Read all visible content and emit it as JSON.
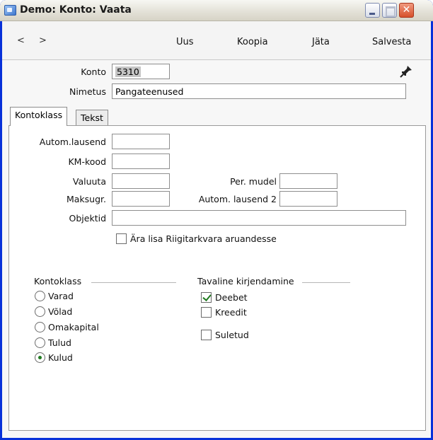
{
  "window": {
    "title": "Demo: Konto: Vaata"
  },
  "toolbar": {
    "back": "<",
    "forward": ">",
    "new_label": "Uus",
    "copy_label": "Koopia",
    "skip_label": "Jäta",
    "save_label": "Salvesta"
  },
  "header": {
    "konto_label": "Konto",
    "konto_value": "5310",
    "nimetus_label": "Nimetus",
    "nimetus_value": "Pangateenused"
  },
  "tabs": [
    {
      "label": "Kontoklass"
    },
    {
      "label": "Tekst"
    }
  ],
  "form": {
    "autom_lausend_label": "Autom.lausend",
    "autom_lausend_value": "",
    "km_kood_label": "KM-kood",
    "km_kood_value": "",
    "valuuta_label": "Valuuta",
    "valuuta_value": "",
    "per_mudel_label": "Per. mudel",
    "per_mudel_value": "",
    "maksugr_label": "Maksugr.",
    "maksugr_value": "",
    "autom_lausend2_label": "Autom. lausend 2",
    "autom_lausend2_value": "",
    "objektid_label": "Objektid",
    "objektid_value": "",
    "ara_lisa_label": "Ära lisa Riigitarkvara aruandesse",
    "ara_lisa_checked": false
  },
  "kontoklass": {
    "title": "Kontoklass",
    "options": [
      {
        "label": "Varad",
        "selected": false
      },
      {
        "label": "Võlad",
        "selected": false
      },
      {
        "label": "Omakapital",
        "selected": false
      },
      {
        "label": "Tulud",
        "selected": false
      },
      {
        "label": "Kulud",
        "selected": true
      }
    ]
  },
  "tavaline": {
    "title": "Tavaline kirjendamine",
    "deebet_label": "Deebet",
    "deebet_checked": true,
    "kreedit_label": "Kreedit",
    "kreedit_checked": false,
    "suletud_label": "Suletud",
    "suletud_checked": false
  }
}
